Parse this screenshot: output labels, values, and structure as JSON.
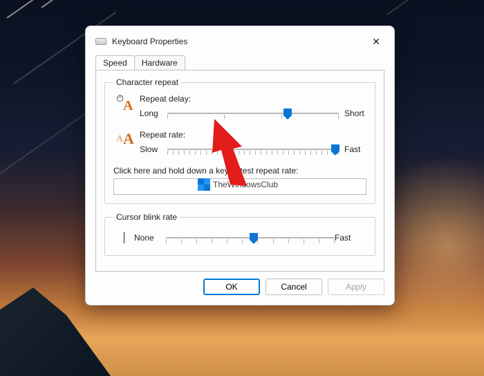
{
  "window": {
    "title": "Keyboard Properties"
  },
  "tabs": {
    "speed": "Speed",
    "hardware": "Hardware"
  },
  "char_repeat": {
    "legend": "Character repeat",
    "delay_label": "Repeat delay:",
    "delay_min": "Long",
    "delay_max": "Short",
    "rate_label": "Repeat rate:",
    "rate_min": "Slow",
    "rate_max": "Fast",
    "test_label": "Click here and hold down a key to test repeat rate:",
    "test_value": ""
  },
  "blink": {
    "legend": "Cursor blink rate",
    "min": "None",
    "max": "Fast"
  },
  "buttons": {
    "ok": "OK",
    "cancel": "Cancel",
    "apply": "Apply"
  },
  "watermark": "TheWindowsClub",
  "sliders": {
    "delay_percent": 70,
    "rate_percent": 98,
    "blink_percent": 52
  }
}
